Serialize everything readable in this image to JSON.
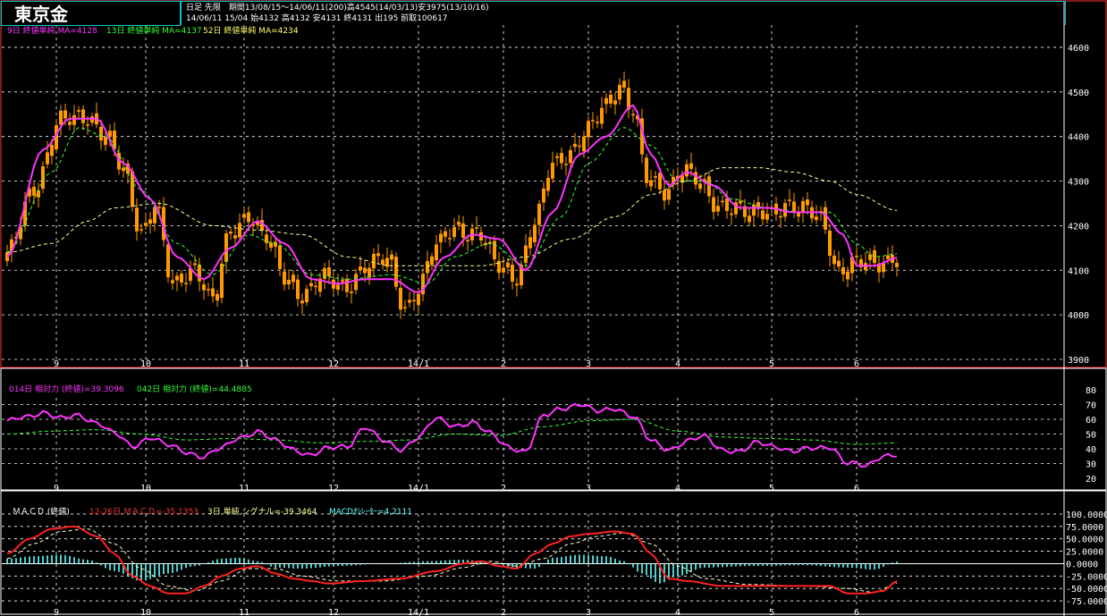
{
  "header": {
    "instrument": "東京金",
    "info_line1": "日足 先限　期間13/08/15～14/06/11(200)高4545(14/03/13)安3975(13/10/16)",
    "info_line2": "14/06/11 15/04 始4132 高4132 安4131 終4131 出195 前取100617"
  },
  "colors": {
    "background": "#000000",
    "grid": "#ffffff",
    "candle_up": "#ff9900",
    "ma9": "#ff33ff",
    "ma13": "#33ff33",
    "ma52": "#ffff99",
    "rsi14": "#ff33ff",
    "rsi42": "#33ff33",
    "macd": "#ff2020",
    "signal": "#ffffcc",
    "osc": "#66ffff",
    "frame": "#ff3333",
    "border": "#00c8c8"
  },
  "price_legend": {
    "ma9": "9日 終値単純 MA=4128",
    "ma13": "13日 終値単純 MA=4137",
    "ma52": "52日 終値単純 MA=4234"
  },
  "rsi_legend": {
    "rsi14": "014日 相対力 (終値)=39.3096",
    "rsi42": "042日 相対力 (終値)=44.4885"
  },
  "macd_legend": {
    "name": "ＭＡＣＤ (終値)",
    "macd": "12-26日 ＭＡＣＤ=-35.1353",
    "signal": "3日 単純 シグナル=-39.3464",
    "osc": "MACDｵｼﾚｰﾀｰ=4.2111"
  },
  "chart_data": [
    {
      "type": "candlestick",
      "x_labels": [
        "9",
        "10",
        "11",
        "12",
        "14/1",
        "2",
        "3",
        "4",
        "5",
        "6"
      ],
      "ylim": [
        3900,
        4650
      ],
      "y_ticks": [
        4600,
        4500,
        4400,
        4300,
        4200,
        4100,
        4000,
        3900
      ],
      "y_tick_labels": [
        "4600",
        "4500",
        "4400",
        "4300",
        "4200",
        "4100",
        "4000",
        "3900"
      ],
      "close_anchors": [
        [
          0,
          4130
        ],
        [
          6,
          4290
        ],
        [
          12,
          4430
        ],
        [
          18,
          4450
        ],
        [
          22,
          4400
        ],
        [
          26,
          4320
        ],
        [
          30,
          4190
        ],
        [
          33,
          4250
        ],
        [
          37,
          4060
        ],
        [
          42,
          4110
        ],
        [
          46,
          4030
        ],
        [
          50,
          4180
        ],
        [
          54,
          4230
        ],
        [
          58,
          4170
        ],
        [
          62,
          4080
        ],
        [
          66,
          4050
        ],
        [
          70,
          4080
        ],
        [
          75,
          4060
        ],
        [
          80,
          4110
        ],
        [
          85,
          4120
        ],
        [
          89,
          4020
        ],
        [
          92,
          4060
        ],
        [
          96,
          4150
        ],
        [
          100,
          4200
        ],
        [
          105,
          4180
        ],
        [
          110,
          4110
        ],
        [
          114,
          4090
        ],
        [
          118,
          4200
        ],
        [
          122,
          4340
        ],
        [
          126,
          4370
        ],
        [
          130,
          4410
        ],
        [
          134,
          4470
        ],
        [
          137,
          4520
        ],
        [
          140,
          4460
        ],
        [
          143,
          4300
        ],
        [
          147,
          4280
        ],
        [
          151,
          4330
        ],
        [
          155,
          4290
        ],
        [
          158,
          4250
        ],
        [
          162,
          4250
        ],
        [
          166,
          4220
        ],
        [
          170,
          4230
        ],
        [
          174,
          4250
        ],
        [
          178,
          4230
        ],
        [
          182,
          4220
        ],
        [
          186,
          4100
        ],
        [
          190,
          4110
        ],
        [
          194,
          4120
        ],
        [
          199,
          4131
        ]
      ],
      "ma9_anchors": [
        [
          0,
          4130
        ],
        [
          8,
          4370
        ],
        [
          14,
          4440
        ],
        [
          20,
          4440
        ],
        [
          26,
          4340
        ],
        [
          32,
          4260
        ],
        [
          38,
          4130
        ],
        [
          44,
          4080
        ],
        [
          50,
          4150
        ],
        [
          56,
          4210
        ],
        [
          62,
          4160
        ],
        [
          68,
          4080
        ],
        [
          74,
          4070
        ],
        [
          80,
          4080
        ],
        [
          86,
          4080
        ],
        [
          92,
          4050
        ],
        [
          98,
          4130
        ],
        [
          104,
          4180
        ],
        [
          110,
          4170
        ],
        [
          116,
          4100
        ],
        [
          122,
          4230
        ],
        [
          128,
          4360
        ],
        [
          134,
          4400
        ],
        [
          140,
          4470
        ],
        [
          144,
          4360
        ],
        [
          148,
          4290
        ],
        [
          152,
          4320
        ],
        [
          158,
          4290
        ],
        [
          164,
          4240
        ],
        [
          170,
          4240
        ],
        [
          176,
          4230
        ],
        [
          182,
          4230
        ],
        [
          187,
          4180
        ],
        [
          190,
          4110
        ],
        [
          194,
          4110
        ],
        [
          199,
          4128
        ]
      ],
      "ma13_anchors": [
        [
          0,
          4140
        ],
        [
          10,
          4320
        ],
        [
          16,
          4420
        ],
        [
          22,
          4400
        ],
        [
          30,
          4280
        ],
        [
          38,
          4160
        ],
        [
          46,
          4090
        ],
        [
          54,
          4180
        ],
        [
          60,
          4160
        ],
        [
          68,
          4090
        ],
        [
          76,
          4080
        ],
        [
          86,
          4090
        ],
        [
          94,
          4070
        ],
        [
          100,
          4130
        ],
        [
          108,
          4160
        ],
        [
          116,
          4110
        ],
        [
          124,
          4220
        ],
        [
          130,
          4340
        ],
        [
          138,
          4420
        ],
        [
          144,
          4380
        ],
        [
          150,
          4300
        ],
        [
          156,
          4300
        ],
        [
          162,
          4260
        ],
        [
          170,
          4240
        ],
        [
          178,
          4230
        ],
        [
          184,
          4230
        ],
        [
          190,
          4160
        ],
        [
          194,
          4130
        ],
        [
          199,
          4137
        ]
      ],
      "ma52_anchors": [
        [
          0,
          4140
        ],
        [
          10,
          4160
        ],
        [
          18,
          4210
        ],
        [
          24,
          4240
        ],
        [
          34,
          4250
        ],
        [
          46,
          4200
        ],
        [
          56,
          4190
        ],
        [
          66,
          4180
        ],
        [
          76,
          4130
        ],
        [
          86,
          4110
        ],
        [
          96,
          4110
        ],
        [
          106,
          4110
        ],
        [
          116,
          4130
        ],
        [
          126,
          4170
        ],
        [
          136,
          4220
        ],
        [
          144,
          4270
        ],
        [
          152,
          4300
        ],
        [
          160,
          4330
        ],
        [
          168,
          4330
        ],
        [
          176,
          4320
        ],
        [
          184,
          4300
        ],
        [
          190,
          4270
        ],
        [
          199,
          4234
        ]
      ]
    },
    {
      "type": "line",
      "name": "RSI",
      "ylim": [
        20,
        80
      ],
      "y_ticks": [
        80,
        70,
        60,
        50,
        40,
        30,
        20
      ],
      "rsi14_anchors": [
        [
          0,
          58
        ],
        [
          4,
          62
        ],
        [
          8,
          65
        ],
        [
          12,
          60
        ],
        [
          16,
          63
        ],
        [
          20,
          58
        ],
        [
          24,
          50
        ],
        [
          28,
          42
        ],
        [
          32,
          48
        ],
        [
          36,
          42
        ],
        [
          40,
          38
        ],
        [
          44,
          35
        ],
        [
          48,
          40
        ],
        [
          52,
          48
        ],
        [
          56,
          52
        ],
        [
          60,
          45
        ],
        [
          64,
          40
        ],
        [
          68,
          36
        ],
        [
          72,
          40
        ],
        [
          76,
          42
        ],
        [
          80,
          55
        ],
        [
          84,
          45
        ],
        [
          88,
          40
        ],
        [
          92,
          48
        ],
        [
          96,
          60
        ],
        [
          100,
          56
        ],
        [
          104,
          58
        ],
        [
          108,
          50
        ],
        [
          112,
          42
        ],
        [
          116,
          38
        ],
        [
          120,
          62
        ],
        [
          124,
          68
        ],
        [
          128,
          70
        ],
        [
          132,
          65
        ],
        [
          136,
          68
        ],
        [
          140,
          62
        ],
        [
          144,
          45
        ],
        [
          148,
          40
        ],
        [
          152,
          45
        ],
        [
          156,
          48
        ],
        [
          160,
          40
        ],
        [
          164,
          38
        ],
        [
          168,
          44
        ],
        [
          172,
          42
        ],
        [
          176,
          38
        ],
        [
          180,
          40
        ],
        [
          184,
          42
        ],
        [
          188,
          30
        ],
        [
          192,
          28
        ],
        [
          196,
          36
        ],
        [
          199,
          36
        ]
      ],
      "rsi42_anchors": [
        [
          0,
          50
        ],
        [
          10,
          52
        ],
        [
          20,
          53
        ],
        [
          30,
          50
        ],
        [
          40,
          46
        ],
        [
          50,
          47
        ],
        [
          60,
          46
        ],
        [
          70,
          44
        ],
        [
          80,
          45
        ],
        [
          90,
          46
        ],
        [
          100,
          50
        ],
        [
          110,
          49
        ],
        [
          120,
          55
        ],
        [
          130,
          59
        ],
        [
          140,
          60
        ],
        [
          150,
          52
        ],
        [
          160,
          48
        ],
        [
          170,
          47
        ],
        [
          180,
          46
        ],
        [
          190,
          43
        ],
        [
          199,
          44
        ]
      ]
    },
    {
      "type": "line",
      "name": "MACD",
      "ylim": [
        -87.5,
        112.5
      ],
      "y_ticks": [
        100,
        75,
        50,
        25,
        0,
        -25,
        -50,
        -75
      ],
      "y_tick_labels": [
        "100.0000",
        "75.0000",
        "50.0000",
        "25.0000",
        "0.0000",
        "-25.0000",
        "-50.0000",
        "-75.0000"
      ],
      "macd_anchors": [
        [
          0,
          20
        ],
        [
          5,
          50
        ],
        [
          10,
          70
        ],
        [
          15,
          75
        ],
        [
          20,
          55
        ],
        [
          24,
          20
        ],
        [
          28,
          -25
        ],
        [
          32,
          -45
        ],
        [
          36,
          -60
        ],
        [
          40,
          -60
        ],
        [
          44,
          -45
        ],
        [
          48,
          -25
        ],
        [
          52,
          -10
        ],
        [
          56,
          -5
        ],
        [
          60,
          -20
        ],
        [
          64,
          -30
        ],
        [
          68,
          -35
        ],
        [
          72,
          -40
        ],
        [
          80,
          -35
        ],
        [
          88,
          -30
        ],
        [
          96,
          -15
        ],
        [
          102,
          0
        ],
        [
          106,
          5
        ],
        [
          110,
          -5
        ],
        [
          114,
          -10
        ],
        [
          118,
          20
        ],
        [
          122,
          40
        ],
        [
          126,
          55
        ],
        [
          130,
          60
        ],
        [
          136,
          65
        ],
        [
          140,
          60
        ],
        [
          144,
          20
        ],
        [
          148,
          -30
        ],
        [
          152,
          -35
        ],
        [
          160,
          -45
        ],
        [
          168,
          -45
        ],
        [
          176,
          -45
        ],
        [
          184,
          -45
        ],
        [
          188,
          -60
        ],
        [
          192,
          -60
        ],
        [
          196,
          -55
        ],
        [
          199,
          -35
        ]
      ],
      "signal_anchors": [
        [
          0,
          10
        ],
        [
          6,
          40
        ],
        [
          12,
          65
        ],
        [
          18,
          70
        ],
        [
          24,
          40
        ],
        [
          30,
          -10
        ],
        [
          36,
          -45
        ],
        [
          42,
          -55
        ],
        [
          48,
          -35
        ],
        [
          54,
          -10
        ],
        [
          60,
          -10
        ],
        [
          66,
          -25
        ],
        [
          74,
          -35
        ],
        [
          84,
          -35
        ],
        [
          94,
          -25
        ],
        [
          102,
          -8
        ],
        [
          108,
          5
        ],
        [
          114,
          -5
        ],
        [
          120,
          10
        ],
        [
          126,
          40
        ],
        [
          132,
          55
        ],
        [
          138,
          62
        ],
        [
          144,
          40
        ],
        [
          150,
          -5
        ],
        [
          156,
          -30
        ],
        [
          166,
          -42
        ],
        [
          178,
          -45
        ],
        [
          188,
          -50
        ],
        [
          194,
          -58
        ],
        [
          199,
          -39
        ]
      ],
      "osc_anchors": [
        [
          0,
          10
        ],
        [
          6,
          15
        ],
        [
          12,
          18
        ],
        [
          18,
          8
        ],
        [
          24,
          -15
        ],
        [
          30,
          -35
        ],
        [
          36,
          -20
        ],
        [
          42,
          -5
        ],
        [
          48,
          10
        ],
        [
          52,
          12
        ],
        [
          56,
          5
        ],
        [
          60,
          -8
        ],
        [
          66,
          -10
        ],
        [
          74,
          -5
        ],
        [
          84,
          0
        ],
        [
          94,
          5
        ],
        [
          102,
          8
        ],
        [
          108,
          2
        ],
        [
          114,
          -8
        ],
        [
          118,
          -10
        ],
        [
          122,
          12
        ],
        [
          128,
          18
        ],
        [
          134,
          15
        ],
        [
          138,
          5
        ],
        [
          142,
          -20
        ],
        [
          146,
          -40
        ],
        [
          150,
          -25
        ],
        [
          156,
          -8
        ],
        [
          166,
          -5
        ],
        [
          178,
          -3
        ],
        [
          188,
          -8
        ],
        [
          194,
          -12
        ],
        [
          199,
          4
        ]
      ]
    }
  ]
}
